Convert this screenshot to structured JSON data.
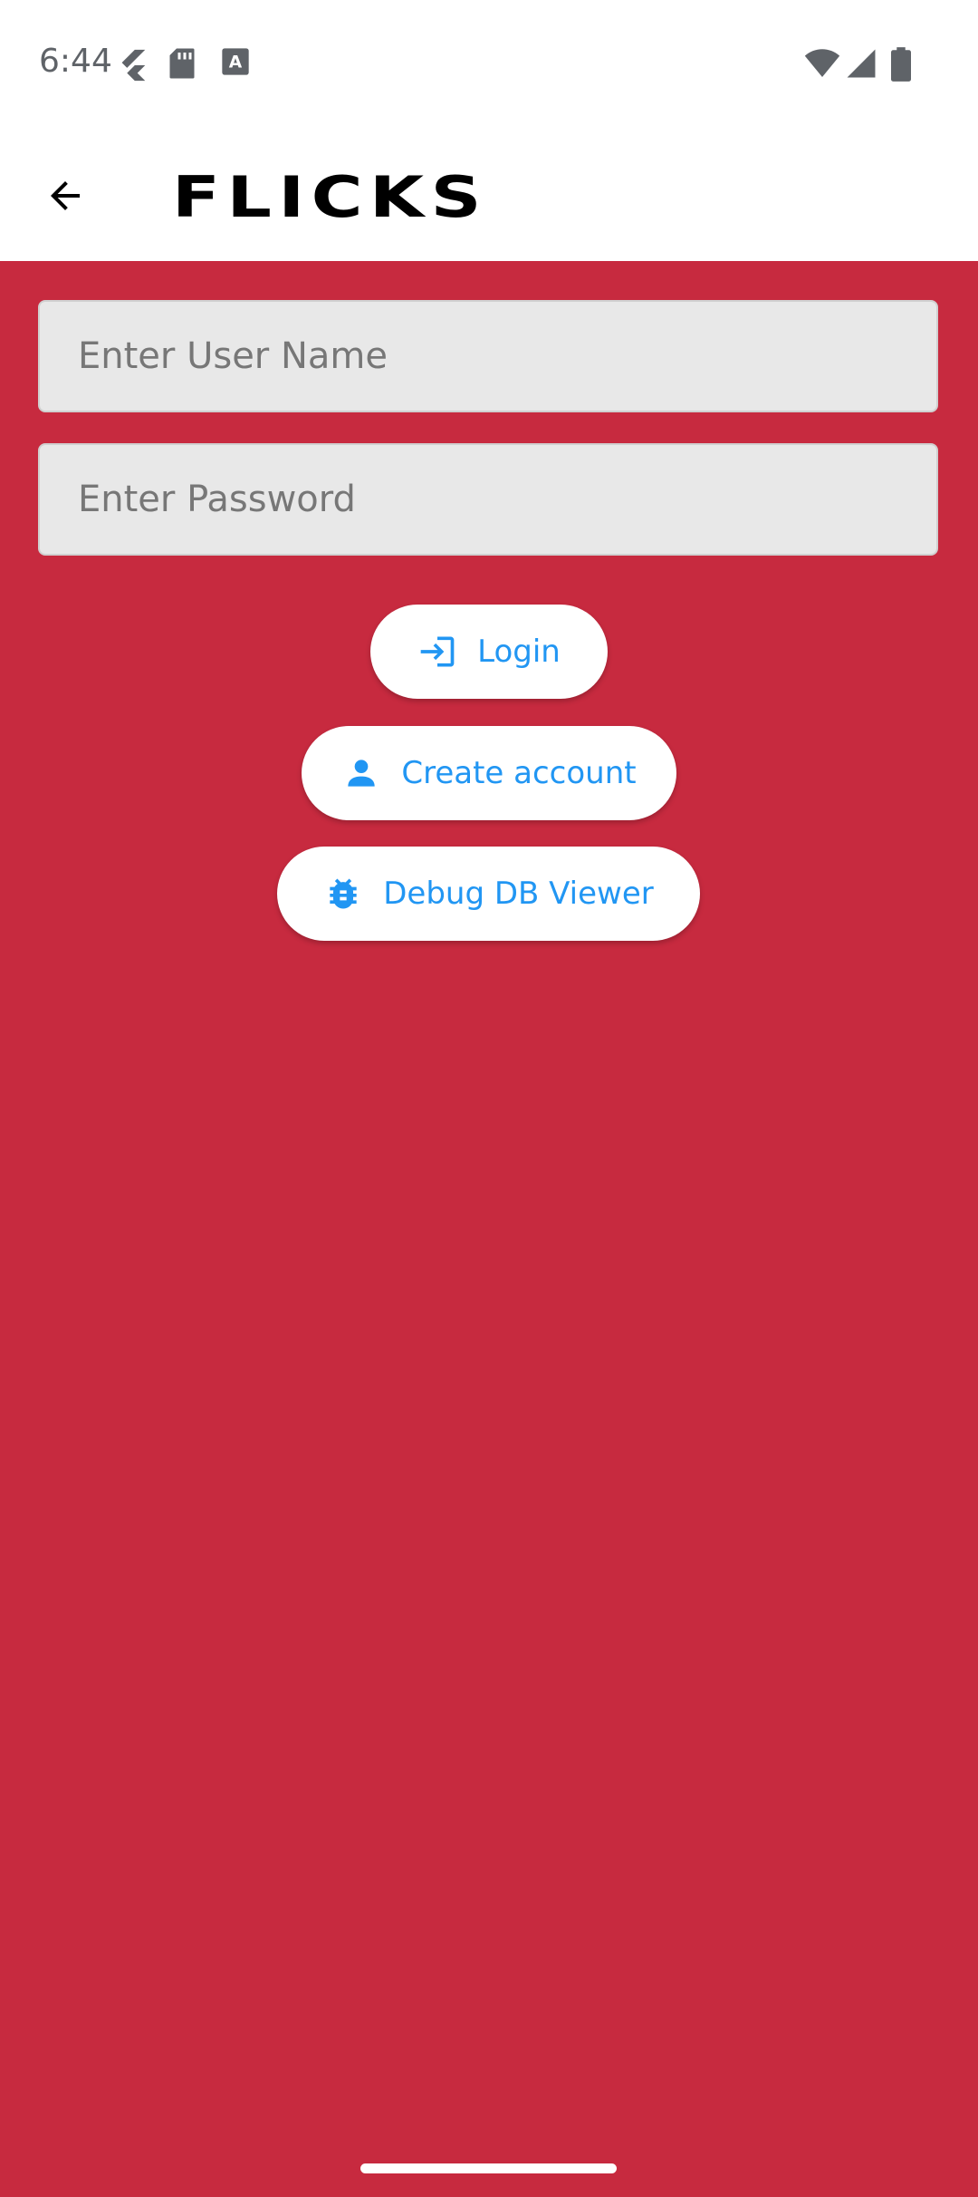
{
  "status_bar": {
    "time": "6:44",
    "left_icons": [
      "flutter-icon",
      "sd-card-icon",
      "keyboard-a-icon"
    ],
    "right_icons": [
      "wifi-icon",
      "cell-signal-icon",
      "battery-icon"
    ]
  },
  "app_bar": {
    "back_icon": "arrow-back-icon",
    "title": "FLICKS"
  },
  "form": {
    "username_placeholder": "Enter User Name",
    "password_placeholder": "Enter Password"
  },
  "buttons": {
    "login": {
      "label": "Login",
      "icon": "login-icon"
    },
    "create_account": {
      "label": "Create account",
      "icon": "person-icon"
    },
    "debug_db": {
      "label": "Debug DB Viewer",
      "icon": "bug-icon"
    }
  },
  "colors": {
    "background": "#C72A3F",
    "accent": "#2196F3",
    "field_bg": "#E8E8E8"
  }
}
